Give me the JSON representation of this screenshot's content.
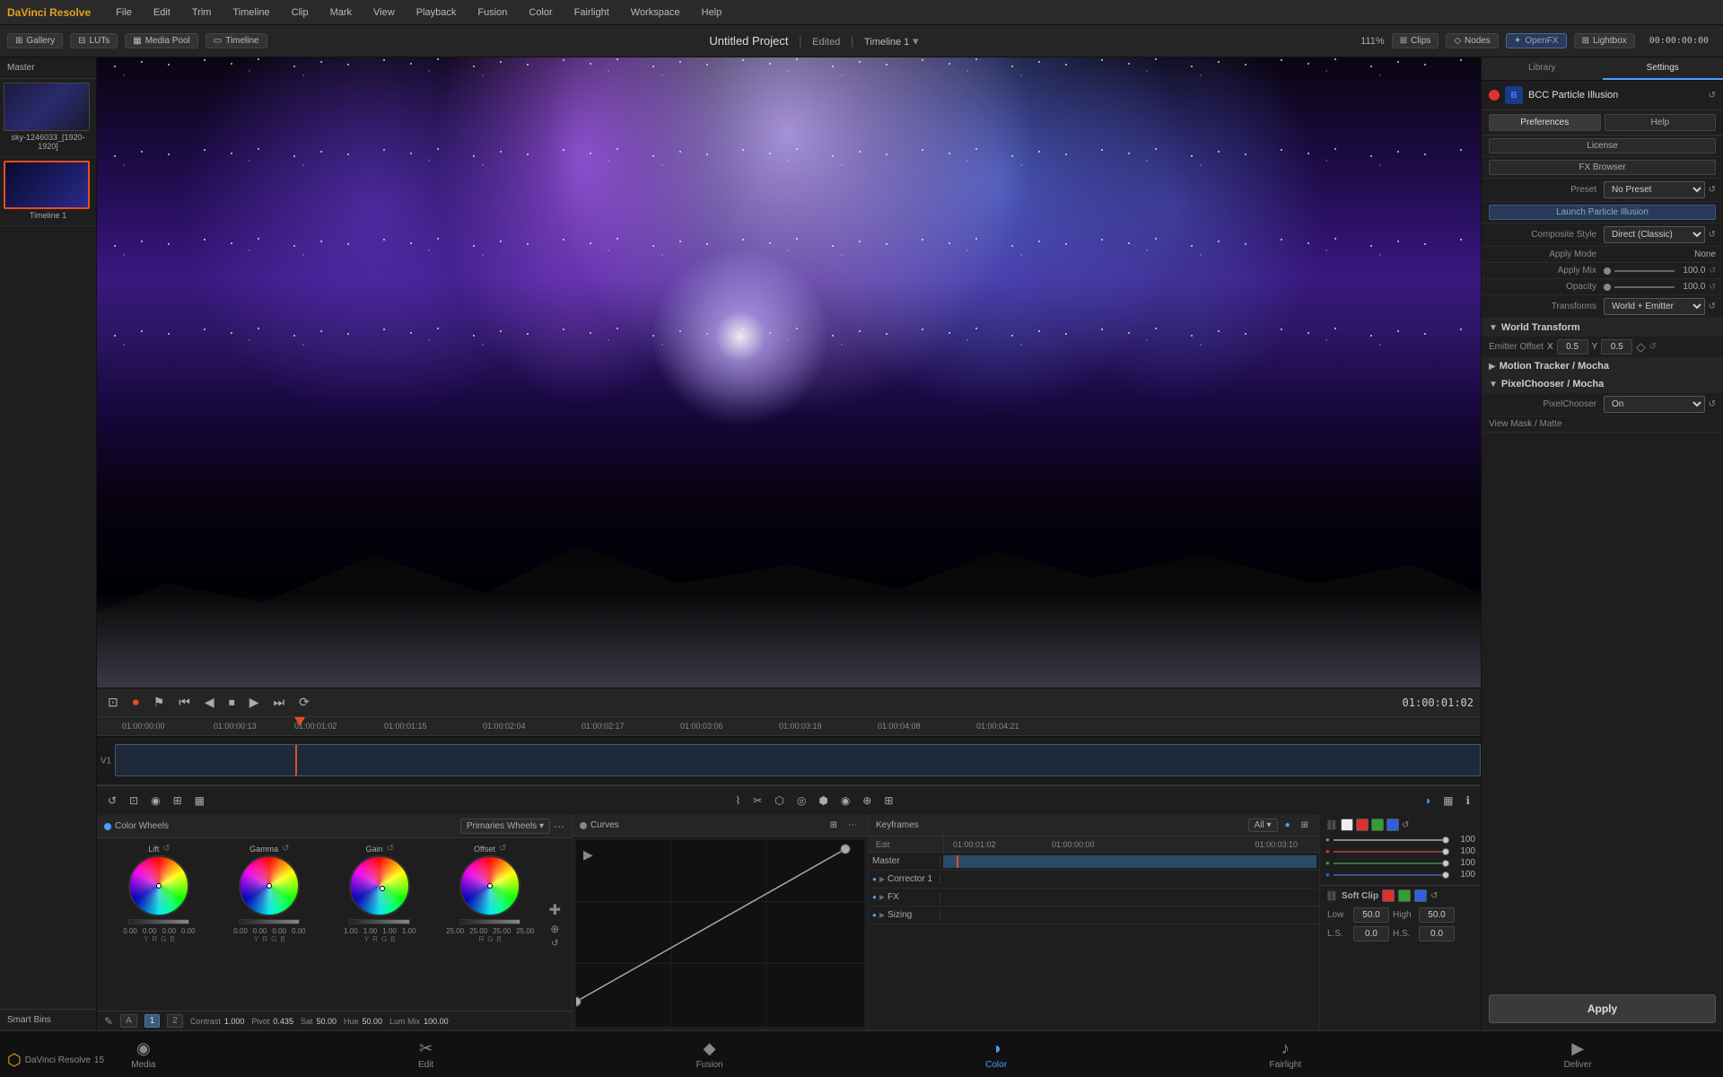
{
  "app": {
    "name": "DaVinci Resolve",
    "version": "15"
  },
  "menu": {
    "items": [
      "File",
      "Edit",
      "Trim",
      "Timeline",
      "Clip",
      "Mark",
      "View",
      "Playback",
      "Fusion",
      "Color",
      "Fairlight",
      "Workspace",
      "Help"
    ]
  },
  "toolbar": {
    "gallery_label": "Gallery",
    "luts_label": "LUTs",
    "media_pool_label": "Media Pool",
    "timeline_label": "Timeline",
    "project_title": "Untitled Project",
    "edited_badge": "Edited",
    "timeline_name": "Timeline 1",
    "zoom_level": "111%",
    "timecode": "00:00:00:00",
    "clips_label": "Clips",
    "nodes_label": "Nodes",
    "openfx_label": "OpenFX",
    "lightbox_label": "Lightbox"
  },
  "left_panel": {
    "master_label": "Master",
    "media_items": [
      {
        "name": "sky-1246033_[1920-1920]",
        "type": "clip"
      },
      {
        "name": "Timeline 1",
        "type": "timeline"
      }
    ],
    "smart_bins_label": "Smart Bins"
  },
  "viewer": {
    "timecode": "01:00:01:02",
    "ruler_marks": [
      "01:00:00:00",
      "01:00:00:13",
      "01:00:01:02",
      "01:00:01:15",
      "01:00:02:04",
      "01:00:02:17",
      "01:00:03:06",
      "01:00:03:19",
      "01:00:04:08",
      "01:00:04:21"
    ]
  },
  "openfx": {
    "panel_tabs": [
      {
        "label": "Library",
        "active": false
      },
      {
        "label": "Settings",
        "active": true
      }
    ],
    "fx_name": "BCC Particle Illusion",
    "sub_tabs": [
      {
        "label": "Preferences",
        "active": true
      },
      {
        "label": "Help",
        "active": false
      }
    ],
    "license_label": "License",
    "fx_browser_label": "FX Browser",
    "preset_label": "Preset",
    "preset_value": "No Preset",
    "launch_label": "Launch Particle Illusion",
    "composite_style_label": "Composite Style",
    "composite_style_value": "Direct (Classic)",
    "apply_mode_label": "Apply Mode",
    "apply_mode_value": "None",
    "apply_mix_label": "Apply Mix",
    "apply_mix_value": "100.0",
    "opacity_label": "Opacity",
    "opacity_value": "100.0",
    "transforms_label": "Transforms",
    "transforms_value": "World + Emitter",
    "world_transform_label": "World Transform",
    "emitter_offset_label": "Emitter Offset",
    "emitter_x_label": "X",
    "emitter_x_value": "0.5",
    "emitter_y_label": "Y",
    "emitter_y_value": "0.5",
    "motion_tracker_label": "Motion Tracker / Mocha",
    "pixelchooser_label": "PixelChooser / Mocha",
    "pixelchooser_label2": "PixelChooser",
    "pixelchooser_value": "On",
    "view_mask_label": "View Mask / Matte",
    "apply_label": "Apply"
  },
  "color_wheels": {
    "panel_label": "Color Wheels",
    "mode_label": "Primaries Wheels",
    "wheels": [
      {
        "label": "Lift",
        "y": "0.00",
        "r": "0.00",
        "g": "0.00",
        "b": "0.00"
      },
      {
        "label": "Gamma",
        "y": "0.00",
        "r": "0.00",
        "g": "0.00",
        "b": "0.00"
      },
      {
        "label": "Gain",
        "y": "1.00",
        "r": "1.00",
        "g": "1.00",
        "b": "1.00"
      },
      {
        "label": "Offset",
        "y": "25.00",
        "r": "25.00",
        "g": "25.00",
        "b": "25.00"
      }
    ],
    "contrast_label": "Contrast",
    "contrast_value": "1.000",
    "pivot_label": "Pivot",
    "pivot_value": "0.435",
    "sat_label": "Sat",
    "sat_value": "50.00",
    "hue_label": "Hue",
    "hue_value": "50.00",
    "lum_mix_label": "Lum Mix",
    "lum_mix_value": "100.00"
  },
  "curves": {
    "panel_label": "Curves"
  },
  "keyframes": {
    "panel_label": "Keyframes",
    "mode_label": "All",
    "timecode_start": "01:00:01:02",
    "timecode_2": "01:00:00:00",
    "timecode_end": "01:00:03:10",
    "edit_label": "Edit",
    "master_label": "Master",
    "corrector1_label": "Corrector 1",
    "fx_label": "FX",
    "sizing_label": "Sizing",
    "colors": {
      "r": "#e03030",
      "g": "#30a030",
      "b": "#3060e0"
    }
  },
  "edit_panel": {
    "soft_clip_label": "Soft Clip",
    "low_label": "Low",
    "low_value": "50.0",
    "high_label": "High",
    "high_value": "50.0",
    "ls_label": "L.S.",
    "ls_value": "0.0",
    "hs_label": "H.S.",
    "hs_value": "0.0",
    "sliders": [
      {
        "value": "100"
      },
      {
        "value": "100"
      },
      {
        "value": "100"
      },
      {
        "value": "100"
      }
    ]
  },
  "bottom_nav": {
    "items": [
      "Media",
      "Edit",
      "Fusion",
      "Color",
      "Fairlight",
      "Deliver"
    ],
    "active": "Color",
    "icons": [
      "◉",
      "✂",
      "◆",
      "◑",
      "♪",
      "▶"
    ]
  }
}
